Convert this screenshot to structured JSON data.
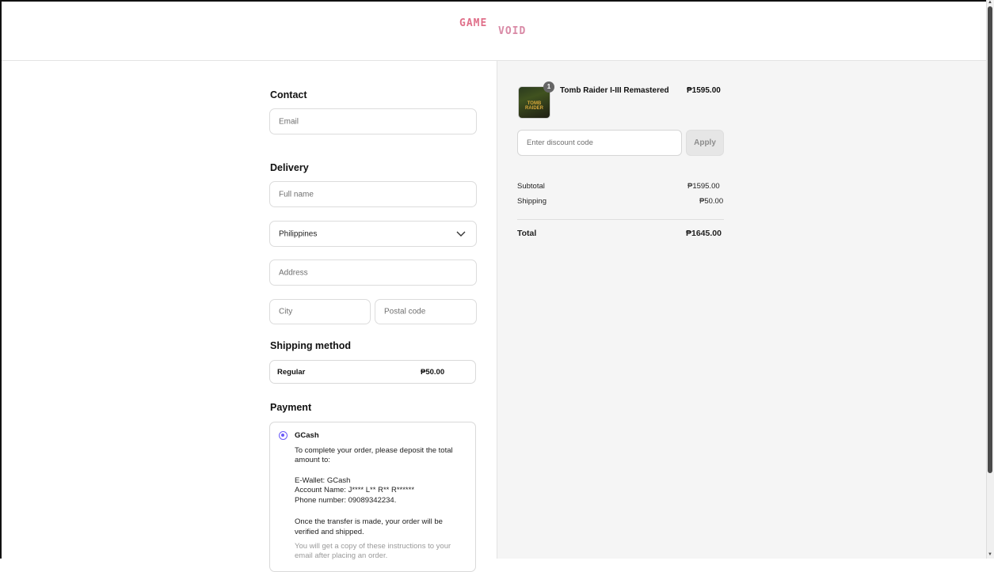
{
  "header": {
    "logo_line1": "GAME",
    "logo_line2": "VOID"
  },
  "contact": {
    "title": "Contact",
    "email_placeholder": "Email"
  },
  "delivery": {
    "title": "Delivery",
    "full_name_placeholder": "Full name",
    "country_value": "Philippines",
    "address_placeholder": "Address",
    "city_placeholder": "City",
    "postal_placeholder": "Postal code"
  },
  "shipping": {
    "title": "Shipping method",
    "method_label": "Regular",
    "method_price": "₱50.00"
  },
  "payment": {
    "title": "Payment",
    "method_label": "GCash",
    "lines": [
      "To complete your order, please deposit the total",
      "amount to:",
      "E-Wallet: GCash",
      "Account Name: J**** L** R** R******",
      "Phone number: 09089342234.",
      "Once the transfer is made, your order will be",
      "verified and shipped.",
      "You will get a copy of these instructions to your",
      "email after placing an order."
    ],
    "accent_color": "#6a5af9"
  },
  "summary": {
    "item": {
      "name": "Tomb Raider I-III Remastered",
      "price": "₱1595.00",
      "quantity_badge": "1",
      "thumb_text": "TOMB RAIDER"
    },
    "discount_placeholder": "Enter discount code",
    "apply_label": "Apply",
    "subtotal_label": "Subtotal",
    "subtotal_value": "₱1595.00",
    "shipping_label": "Shipping",
    "shipping_value": "₱50.00",
    "total_label": "Total",
    "total_value": "₱1645.00"
  }
}
